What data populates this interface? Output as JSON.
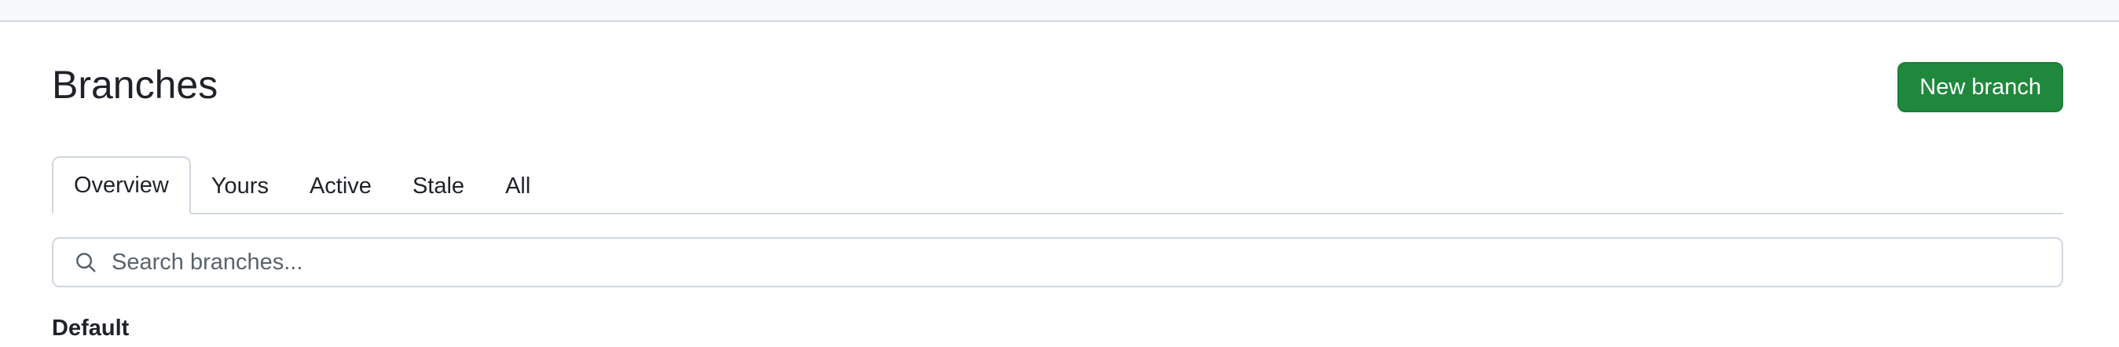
{
  "page": {
    "title": "Branches",
    "new_branch_label": "New branch"
  },
  "tabs": [
    {
      "label": "Overview",
      "selected": true
    },
    {
      "label": "Yours",
      "selected": false
    },
    {
      "label": "Active",
      "selected": false
    },
    {
      "label": "Stale",
      "selected": false
    },
    {
      "label": "All",
      "selected": false
    }
  ],
  "search": {
    "placeholder": "Search branches...",
    "value": "",
    "icon": "search-icon"
  },
  "sections": {
    "default_heading": "Default"
  },
  "colors": {
    "primary_button": "#1f883d",
    "border": "#d0d7de",
    "text": "#1f2328",
    "top_strip": "#f6f8fa"
  }
}
